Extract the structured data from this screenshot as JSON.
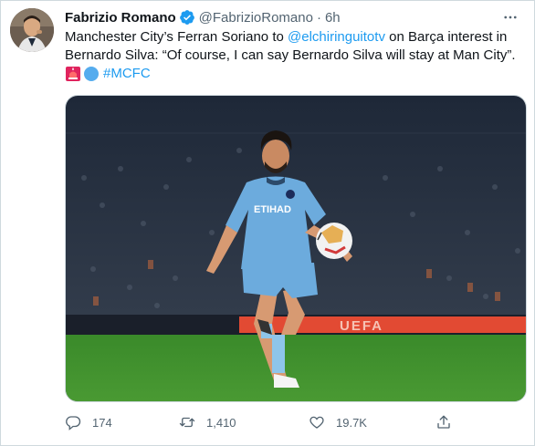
{
  "author": {
    "name": "Fabrizio Romano",
    "handle": "@FabrizioRomano",
    "separator": "·",
    "time": "6h"
  },
  "tweet": {
    "line1_prefix": "Manchester City’s Ferran Soriano to ",
    "mention": "@elchiringuitotv",
    "line1_suffix": " on Barça interest in",
    "line2": "Bernardo Silva: “Of course, I can say Bernardo Silva will stay at Man City”.",
    "hashtag": "#MCFC"
  },
  "media": {
    "banner_text": "UEFA"
  },
  "actions": {
    "replies": "174",
    "retweets": "1,410",
    "likes": "19.7K"
  },
  "colors": {
    "accent": "#1d9bf0",
    "text": "#0f1419",
    "muted": "#536471",
    "pitch": "#3f8f2c",
    "kit": "#6cabdd"
  }
}
